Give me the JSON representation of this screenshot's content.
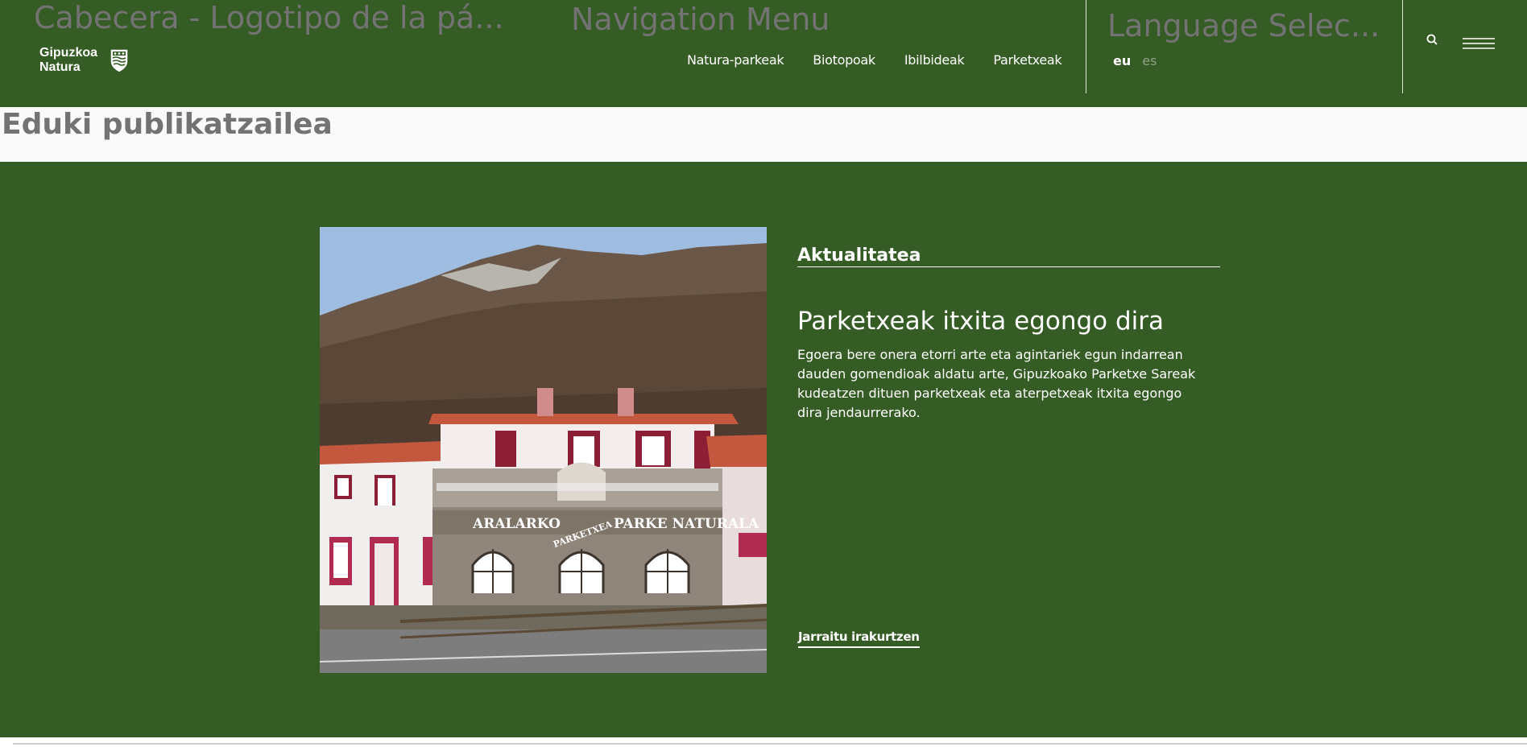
{
  "header": {
    "logo_portlet_title": "Cabecera - Logotipo de la pá...",
    "nav_portlet_title": "Navigation Menu",
    "lang_portlet_title": "Language Selec...",
    "logo": {
      "line1": "Gipuzkoa",
      "line2": "Natura",
      "icon": "coat-of-arms-shield"
    },
    "nav_items": [
      {
        "label": "Natura-parkeak"
      },
      {
        "label": "Biotopoak"
      },
      {
        "label": "Ibilbideak"
      },
      {
        "label": "Parketxeak"
      }
    ],
    "languages": {
      "active": "eu",
      "other": "es"
    },
    "icons": {
      "search": "search-icon",
      "menu": "hamburger-menu-icon"
    }
  },
  "subbar": {
    "title": "Eduki publikatzailea"
  },
  "article": {
    "category": "Aktualitatea",
    "title": "Parketxeak itxita egongo dira",
    "body": "Egoera bere onera etorri arte eta agintariek egun indarrean dauden gomendioak aldatu arte, Gipuzkoako Parketxe Sareak kudeatzen dituen parketxeak eta aterpetxeak itxita egongo dira jendaurrerako.",
    "read_more": "Jarraitu irakurtzen",
    "image": {
      "sign_left": "ARALARKO",
      "sign_right": "PARKE NATURALA",
      "sign_arch": "PARKETXEA"
    }
  },
  "colors": {
    "brand_green": "#365c25",
    "header_placeholder_text": "#737373",
    "white": "#ffffff",
    "inactive_lang": "#8fa086"
  }
}
